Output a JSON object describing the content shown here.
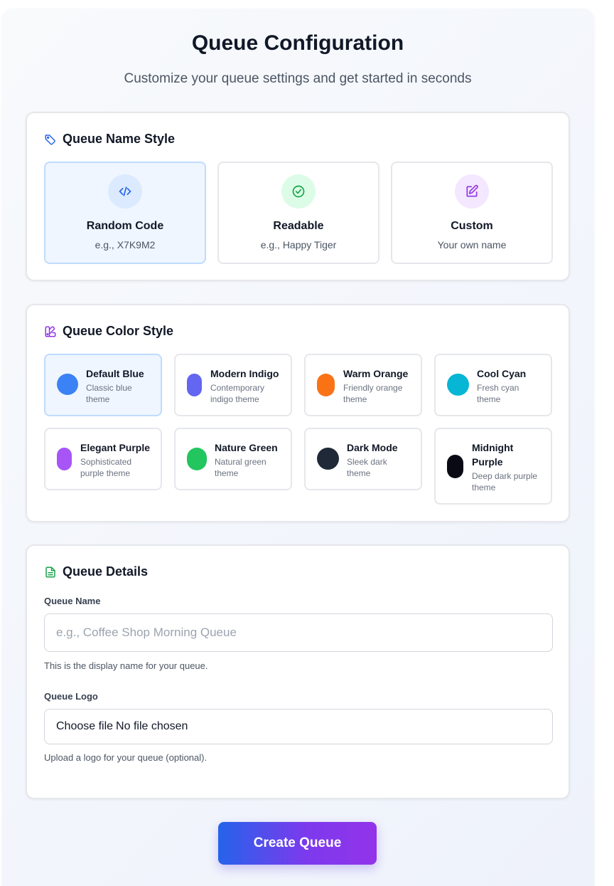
{
  "header": {
    "title": "Queue Configuration",
    "subtitle": "Customize your queue settings and get started in seconds"
  },
  "name_style": {
    "heading": "Queue Name Style",
    "icon": "tag-icon",
    "options": [
      {
        "label": "Random Code",
        "example": "e.g., X7K9M2",
        "icon": "code-icon",
        "selected": true
      },
      {
        "label": "Readable",
        "example": "e.g., Happy Tiger",
        "icon": "check-circle-icon",
        "selected": false
      },
      {
        "label": "Custom",
        "example": "Your own name",
        "icon": "edit-icon",
        "selected": false
      }
    ]
  },
  "color_style": {
    "heading": "Queue Color Style",
    "icon": "palette-icon",
    "options": [
      {
        "name": "Default Blue",
        "desc1": "Classic blue",
        "desc2": "theme",
        "color": "#3b82f6",
        "selected": true
      },
      {
        "name": "Modern Indigo",
        "desc1": "Contemporary",
        "desc2": "indigo theme",
        "color": "#6366f1",
        "selected": false
      },
      {
        "name": "Warm Orange",
        "desc1": "Friendly orange",
        "desc2": "theme",
        "color": "#f97316",
        "selected": false
      },
      {
        "name": "Cool Cyan",
        "desc1": "Fresh cyan",
        "desc2": "theme",
        "color": "#06b6d4",
        "selected": false
      },
      {
        "name": "Elegant Purple",
        "desc1": "Sophisticated",
        "desc2": "purple theme",
        "color": "#a855f7",
        "selected": false
      },
      {
        "name": "Nature Green",
        "desc1": "Natural green",
        "desc2": "theme",
        "color": "#22c55e",
        "selected": false
      },
      {
        "name": "Dark Mode",
        "desc1": "Sleek dark",
        "desc2": "theme",
        "color": "#1f2937",
        "selected": false
      },
      {
        "name1": "Midnight",
        "name2": "Purple",
        "desc1": "Deep dark purple",
        "desc2": "theme",
        "color": "#0a0a14",
        "selected": false
      }
    ]
  },
  "details": {
    "heading": "Queue Details",
    "icon": "document-icon",
    "name_label": "Queue Name",
    "name_placeholder": "e.g., Coffee Shop Morning Queue",
    "name_value": "",
    "name_help": "This is the display name for your queue.",
    "logo_label": "Queue Logo",
    "logo_button": "Choose file",
    "logo_status": "No file chosen",
    "logo_help": "Upload a logo for your queue (optional)."
  },
  "actions": {
    "create_label": "Create Queue"
  },
  "colors": {
    "accent_blue": "#2563eb",
    "accent_purple": "#9333ea",
    "selected_bg": "#eff6ff"
  }
}
